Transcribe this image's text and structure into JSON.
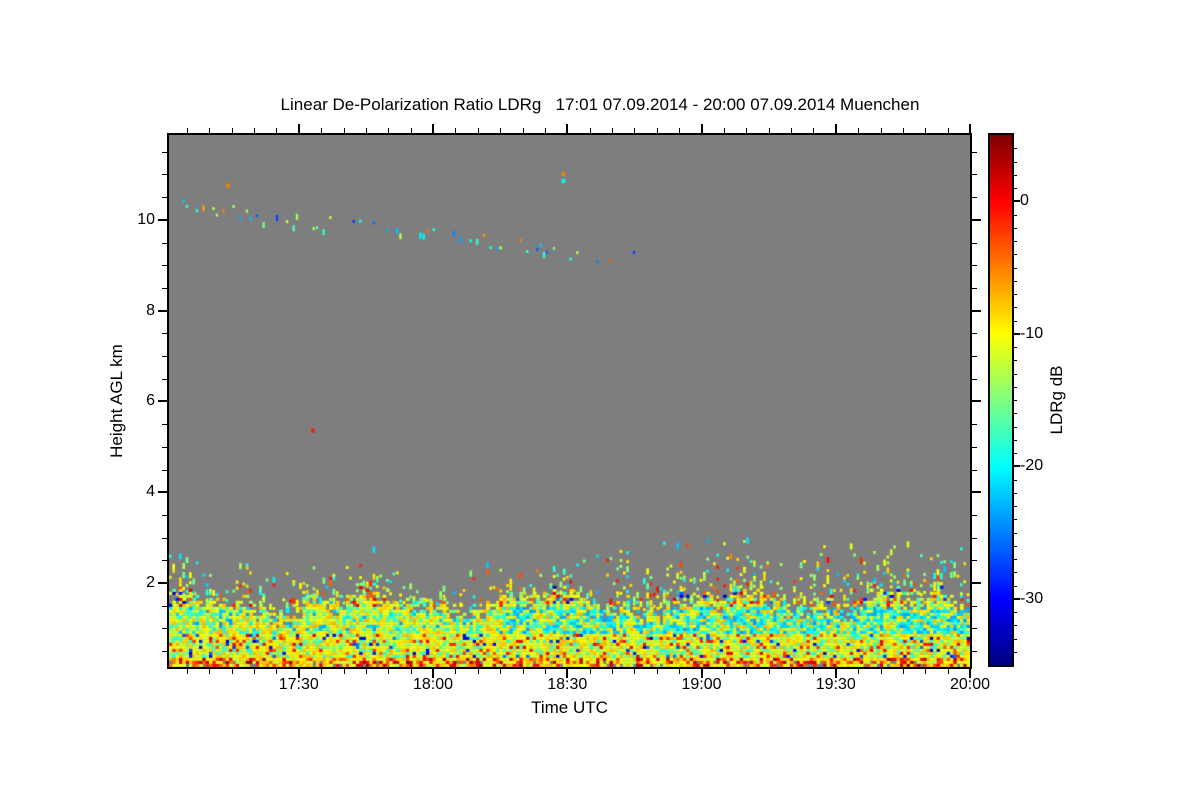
{
  "page": {
    "background": "#ffffff"
  },
  "chart_data": {
    "type": "heatmap",
    "title": "Linear De-Polarization Ratio LDRg   17:01 07.09.2014 - 20:00 07.09.2014 Muenchen",
    "station": "Muenchen",
    "time_start": "17:01 07.09.2014",
    "time_end": "20:00 07.09.2014",
    "xlabel": "Time UTC",
    "ylabel": "Height AGL km",
    "colorbar_label": "LDRg dB",
    "colormap": "jet",
    "no_data_color": "#7e7e7e",
    "x_span_minutes": 179,
    "x_major_ticks": [
      {
        "minutes": 29,
        "label": "17:30"
      },
      {
        "minutes": 59,
        "label": "18:00"
      },
      {
        "minutes": 89,
        "label": "18:30"
      },
      {
        "minutes": 119,
        "label": "19:00"
      },
      {
        "minutes": 149,
        "label": "19:30"
      },
      {
        "minutes": 179,
        "label": "20:00"
      }
    ],
    "x_minor_step_minutes": 5,
    "y_range_km": [
      0.15,
      11.87
    ],
    "y_major_ticks_km": [
      2,
      4,
      6,
      8,
      10
    ],
    "y_minor_step_km": 0.5,
    "colorbar_range_db": [
      -35,
      5
    ],
    "colorbar_major_ticks_db": [
      0,
      -10,
      -20,
      -30
    ],
    "colorbar_minor_step_db": 1,
    "seed": 20140907,
    "features": {
      "boundary_layer": {
        "description": "Noisy aerosol/depolarization layer from ground to ~1.5-2.1 km; mostly -7 to -14 dB (yellow/green), cyan patches -16 to -24 dB, scattered orange/red -5 to +4 dB, rare dark blue below -25 dB; ragged gray-gapped top",
        "base_km": 0.15,
        "top_mean_km": 1.58,
        "top_trend_km_over_period": 0.1,
        "top_jitter_km": 0.15,
        "cyan_layer": {
          "center_km": 1.15,
          "halfwidth_km": 0.28,
          "onset_minutes": 74,
          "value_db_range": [
            -24,
            -16
          ]
        },
        "surface_red": {
          "below_km": 0.3,
          "value_db_range": [
            -5,
            4
          ]
        }
      },
      "elevated_specks": {
        "description": "Sparse yellow/green/cyan specks above boundary-layer top, denser and reaching ~2.9 km after 18:35",
        "max_above_top_km": 0.85,
        "enhanced_after_minutes": 94,
        "enhanced_max_km": 2.9
      },
      "cirrus_track": {
        "description": "Thin descending track of sparse cyan/blue specks (occasional yellow/orange) from ~10.35 km at 17:02 to ~9.15 km near 18:46",
        "start": {
          "minutes": 1,
          "km": 10.35
        },
        "end": {
          "minutes": 105,
          "km": 9.15
        },
        "value_db_range": [
          -28,
          -17
        ],
        "density": 0.38
      },
      "isolated_points": [
        {
          "minutes": 13,
          "km": 10.8,
          "db": -5
        },
        {
          "minutes": 32,
          "km": 5.4,
          "db": -1
        },
        {
          "minutes": 88,
          "km": 11.05,
          "db": -5
        },
        {
          "minutes": 88,
          "km": 10.9,
          "db": -20
        }
      ]
    }
  }
}
